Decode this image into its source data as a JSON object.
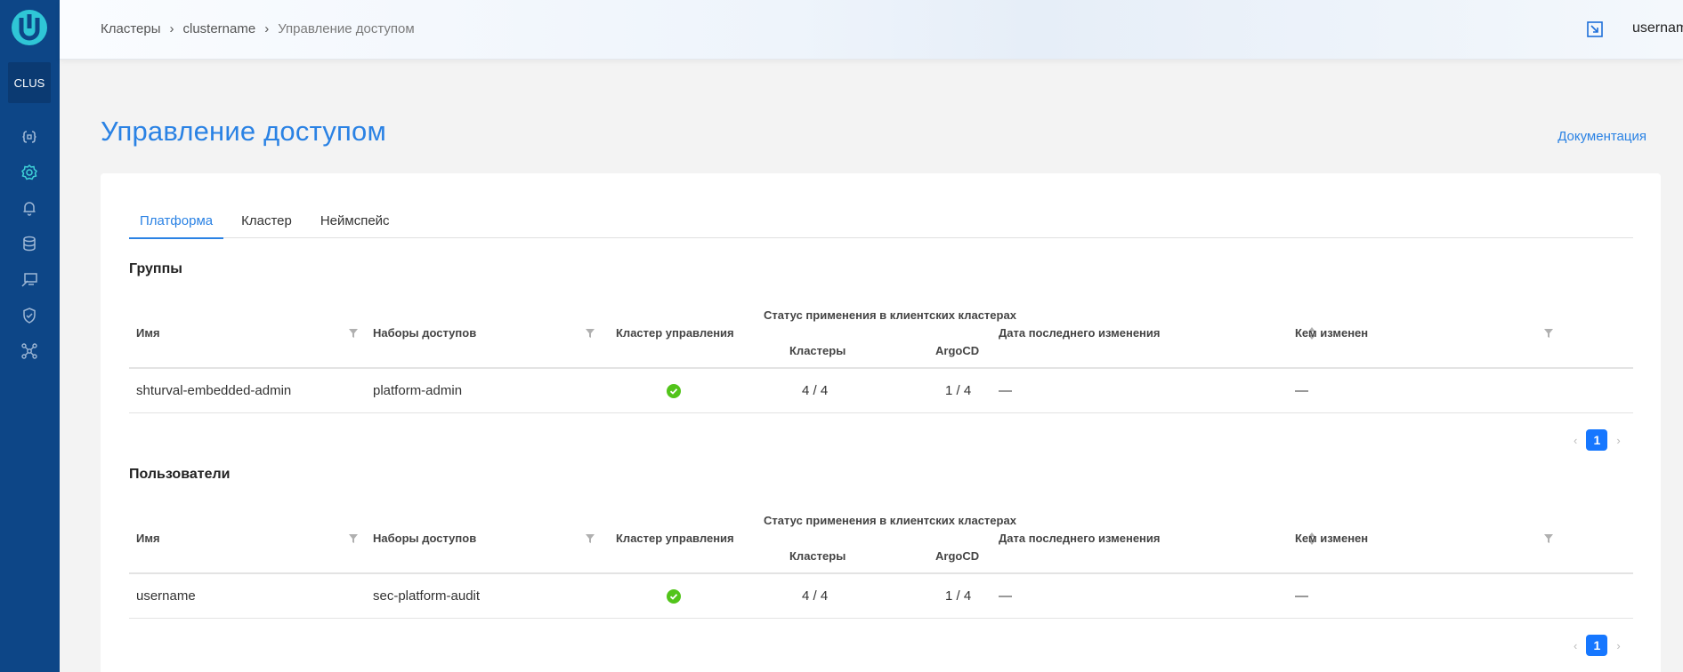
{
  "sidebar": {
    "cluster_badge": "CLUS",
    "icons": [
      "braces-icon",
      "settings-gear-icon",
      "bell-icon",
      "database-icon",
      "monitor-pointer-icon",
      "shield-check-icon",
      "network-icon"
    ]
  },
  "header": {
    "breadcrumbs": [
      "Кластеры",
      "clustername",
      "Управление доступом"
    ],
    "username": "username"
  },
  "page": {
    "title": "Управление доступом",
    "doc_link": "Документация"
  },
  "tabs": [
    "Платформа",
    "Кластер",
    "Неймспейс"
  ],
  "columns": {
    "name": "Имя",
    "access_sets": "Наборы доступов",
    "mgmt_cluster": "Кластер управления",
    "status_group": "Статус применения в клиентских кластерах",
    "clusters": "Кластеры",
    "argocd": "ArgoCD",
    "last_changed": "Дата последнего изменения",
    "changed_by": "Кем изменен"
  },
  "groups": {
    "title": "Группы",
    "rows": [
      {
        "name": "shturval-embedded-admin",
        "access_set": "platform-admin",
        "clusters": "4 / 4",
        "argocd": "1 / 4",
        "last_changed": "—",
        "changed_by": "—"
      }
    ],
    "page": "1"
  },
  "users": {
    "title": "Пользователи",
    "rows": [
      {
        "name": "username",
        "access_set": "sec-platform-audit",
        "clusters": "4 / 4",
        "argocd": "1 / 4",
        "last_changed": "—",
        "changed_by": "—"
      }
    ],
    "page": "1"
  },
  "colors": {
    "sidebar": "#0d4687",
    "accent": "#2a82e4",
    "active_icon": "#3fd3d8",
    "success": "#52c41a",
    "pager": "#1677ff"
  }
}
